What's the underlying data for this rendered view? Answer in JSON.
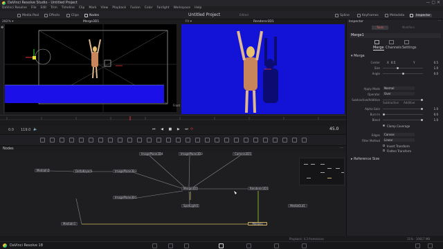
{
  "app": {
    "name": "DaVinci Resolve Studio - Untitled Project",
    "bottom_name": "DaVinci Resolve 18"
  },
  "menu": [
    "DaVinci Resolve",
    "File",
    "Edit",
    "Trim",
    "Timeline",
    "Clip",
    "Mark",
    "View",
    "Playback",
    "Fusion",
    "Color",
    "Fairlight",
    "Workspace",
    "Help"
  ],
  "toolbar": {
    "media_pool": "Media Pool",
    "effects": "Effects",
    "clips": "Clips",
    "nodes": "Nodes",
    "project_title": "Untitled Project",
    "project_status": "Edited",
    "spline": "Spline",
    "keyframes": "Keyframes",
    "metadata": "Metadata",
    "inspector": "Inspector"
  },
  "viewers": {
    "left_zoom": "282% ▾",
    "left_name": "Merge3D1",
    "right_zoom": "Fit ▾",
    "right_name": "Renderer3D1",
    "left_side_label": "Front",
    "perspective": "Persp."
  },
  "timebar": {
    "start": "0.0",
    "end": "119.0",
    "current_frame": "45.0"
  },
  "nodes_panel": {
    "title": "Nodes",
    "nodes": [
      {
        "id": "media_in2",
        "label": "MediaIn2"
      },
      {
        "id": "deltakeyer1",
        "label": "DeltaKeyer1"
      },
      {
        "id": "imageplane3d2",
        "label": "ImagePlane3D2"
      },
      {
        "id": "imageplane3d4",
        "label": "ImagePlane3D4"
      },
      {
        "id": "imageplane3d3",
        "label": "ImagePlane3D3"
      },
      {
        "id": "camera3d1",
        "label": "Camera3D1"
      },
      {
        "id": "merge3d1",
        "label": "Merge3D1"
      },
      {
        "id": "renderer3d1",
        "label": "Renderer3D1"
      },
      {
        "id": "imageplane3d5",
        "label": "ImagePlane3D5"
      },
      {
        "id": "spotlight1",
        "label": "SpotLight1"
      },
      {
        "id": "mediaout1",
        "label": "MediaOut1"
      },
      {
        "id": "media_in1",
        "label": "MediaIn1"
      },
      {
        "id": "merge1",
        "label": "Merge1"
      }
    ]
  },
  "inspector": {
    "title": "Inspector",
    "tab_tools": "Tools",
    "tab_modifiers": "Modifiers",
    "node_name": "Merge1",
    "subtabs": [
      "Merge",
      "Channels",
      "Settings"
    ],
    "section_merge": "Merge",
    "center_label": "Center",
    "center_x": "0.5",
    "center_y": "0.5",
    "size_label": "Size",
    "size_value": "1.0",
    "angle_label": "Angle",
    "angle_value": "0.0",
    "apply_mode_label": "Apply Mode",
    "apply_mode_value": "Normal",
    "operator_label": "Operator",
    "operator_value": "Over",
    "subtractive_additive_label": "Subtractive/Additive",
    "subtractive_label": "Subtractive",
    "additive_label": "Additive",
    "alpha_gain_label": "Alpha Gain",
    "alpha_gain_value": "1.0",
    "burn_in_label": "Burn In",
    "burn_in_value": "0.0",
    "blend_label": "Blend",
    "blend_value": "1.0",
    "clamp_coverage": "Clamp Coverage",
    "edges_label": "Edges",
    "edges_value": "Canvas",
    "filter_method_label": "Filter Method",
    "filter_method_value": "Linear",
    "invert_transform": "Invert Transform",
    "flatten_transform": "Flatten Transform",
    "reference_size": "Reference Size"
  },
  "status": {
    "playback": "Playback: 4.3 frames/sec",
    "memory": "11% - 10817 MB"
  }
}
